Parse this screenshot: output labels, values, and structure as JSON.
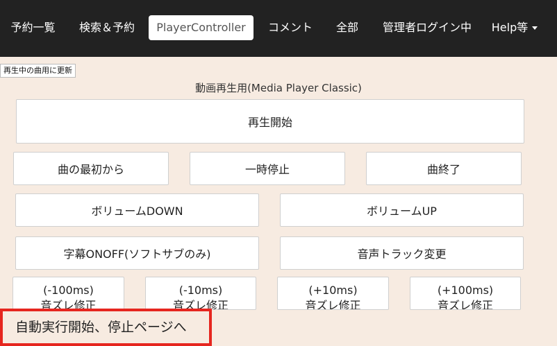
{
  "nav": {
    "items": [
      "予約一覧",
      "検索＆予約",
      "PlayerController",
      "コメント",
      "全部",
      "管理者ログイン中"
    ],
    "help_label": "Help等"
  },
  "refresh_button_label": "再生中の曲用に更新",
  "section_title": "動画再生用(Media Player Classic)",
  "controls": {
    "play": "再生開始",
    "from_start": "曲の最初から",
    "pause": "一時停止",
    "end_song": "曲終了",
    "volume_down": "ボリュームDOWN",
    "volume_up": "ボリュームUP",
    "subtitle_toggle": "字幕ONOFF(ソフトサブのみ)",
    "audio_track": "音声トラック変更",
    "offset_label": "音ズレ修正",
    "offsets": [
      "(-100ms)",
      "(-10ms)",
      "(+10ms)",
      "(+100ms)"
    ]
  },
  "auto_page_link": "自動実行開始、停止ページへ"
}
